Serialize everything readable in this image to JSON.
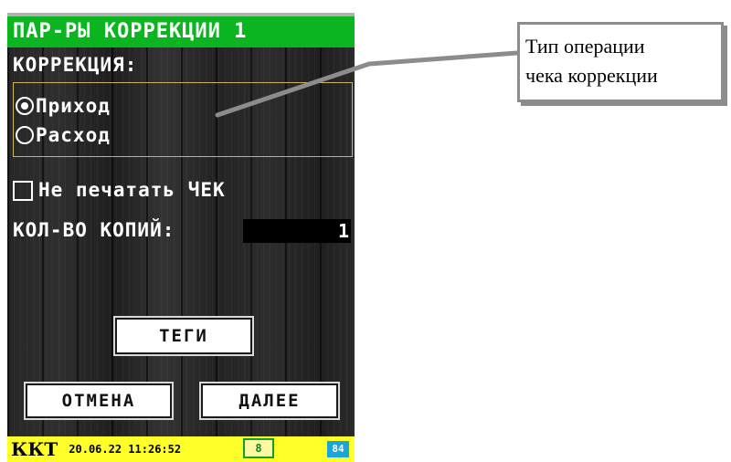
{
  "screen": {
    "title": "ПАР-РЫ КОРРЕКЦИИ 1",
    "correction_label": "КОРРЕКЦИЯ:",
    "radio_options": [
      {
        "label": "Приход",
        "selected": true
      },
      {
        "label": "Расход",
        "selected": false
      }
    ],
    "no_print_label": "Не печатать ЧЕК",
    "no_print_checked": false,
    "copies_label": "КОЛ-ВО КОПИЙ:",
    "copies_value": "1",
    "tags_button": "ТЕГИ",
    "cancel_button": "ОТМЕНА",
    "next_button": "ДАЛЕЕ"
  },
  "status_bar": {
    "kkt": "ККТ",
    "datetime": "20.06.22 11:26:52",
    "badge_indicator": "8",
    "battery": "84"
  },
  "callout": {
    "line1": "Тип операции",
    "line2": "чека коррекции"
  },
  "colors": {
    "title_bar": "#0bb51f",
    "status_bar": "#ffff2a",
    "group_border": "#c9b45a",
    "battery": "#18a7d8"
  }
}
